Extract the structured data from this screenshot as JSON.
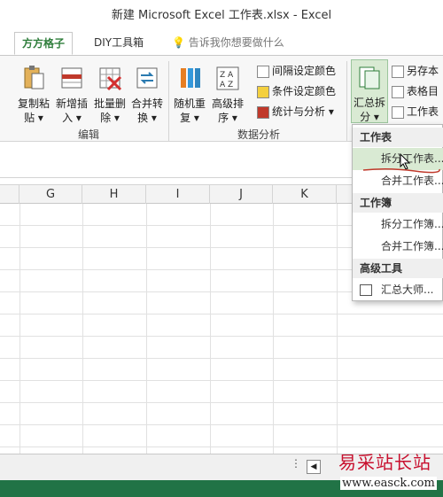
{
  "window": {
    "title": "新建 Microsoft Excel 工作表.xlsx - Excel"
  },
  "tabs": [
    {
      "label": "方方格子",
      "active": true
    },
    {
      "label": "DIY工具箱",
      "active": false
    }
  ],
  "tell_me": {
    "placeholder": "告诉我你想要做什么",
    "icon": "lightbulb-icon"
  },
  "ribbon": {
    "group_edit": {
      "label": "编辑",
      "buttons": [
        {
          "line1": "复制粘",
          "line2": "贴 ▾"
        },
        {
          "line1": "新增插",
          "line2": "入 ▾"
        },
        {
          "line1": "批量删",
          "line2": "除 ▾"
        },
        {
          "line1": "合并转",
          "line2": "换 ▾"
        }
      ]
    },
    "group_analysis": {
      "label": "数据分析",
      "buttons": [
        {
          "line1": "随机重",
          "line2": "复 ▾"
        },
        {
          "line1": "高级排",
          "line2": "序 ▾"
        }
      ],
      "small": [
        {
          "label": "间隔设定颜色"
        },
        {
          "label": "条件设定颜色"
        },
        {
          "label": "统计与分析 ▾"
        }
      ]
    },
    "group_split": {
      "button": {
        "line1": "汇总拆",
        "line2": "分 ▾"
      },
      "small": [
        {
          "label": "另存本"
        },
        {
          "label": "表格目"
        },
        {
          "label": "工作表"
        }
      ]
    }
  },
  "columns": [
    "G",
    "H",
    "I",
    "J",
    "K"
  ],
  "dropdown": {
    "sections": [
      {
        "header": "工作表",
        "items": [
          "拆分工作表...",
          "合并工作表..."
        ]
      },
      {
        "header": "工作簿",
        "items": [
          "拆分工作簿...",
          "合并工作簿..."
        ]
      },
      {
        "header": "高级工具",
        "items": [
          "汇总大师..."
        ]
      }
    ]
  },
  "footer": {
    "scroll_dots": "⋮",
    "watermark": "易采站长站",
    "watermark_url": "www.easck.com"
  },
  "colors": {
    "accent": "#217346",
    "highlight": "#d9ead3",
    "tab_active": "#2e7d3b"
  }
}
